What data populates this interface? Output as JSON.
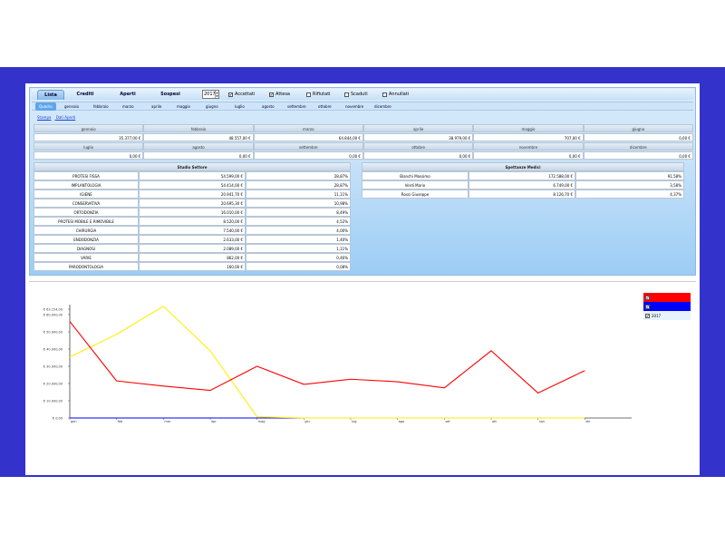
{
  "tabs": [
    "Lista",
    "Crediti",
    "Aperti",
    "Sospesi"
  ],
  "year": "2017",
  "filters": [
    {
      "label": "Accettati",
      "checked": true
    },
    {
      "label": "Attesa",
      "checked": true
    },
    {
      "label": "Rifiutati",
      "checked": false
    },
    {
      "label": "Scaduti",
      "checked": false
    },
    {
      "label": "Annullati",
      "checked": false
    }
  ],
  "month_tabs": [
    "Quadro",
    "gennaio",
    "febbraio",
    "marzo",
    "aprile",
    "maggio",
    "giugno",
    "luglio",
    "agosto",
    "settembre",
    "ottobre",
    "novembre",
    "dicembre"
  ],
  "links": [
    "Stampa",
    "Dati Aperti"
  ],
  "months_row1": [
    {
      "label": "gennaio",
      "value": "35.377,00 €"
    },
    {
      "label": "febbraio",
      "value": "48.557,00 €"
    },
    {
      "label": "marzo",
      "value": "64.844,00 €"
    },
    {
      "label": "aprile",
      "value": "38.979,00 €"
    },
    {
      "label": "maggio",
      "value": "707,00 €"
    },
    {
      "label": "giugno",
      "value": "0,00 €"
    }
  ],
  "months_row2": [
    {
      "label": "luglio",
      "value": "0,00 €"
    },
    {
      "label": "agosto",
      "value": "0,00 €"
    },
    {
      "label": "settembre",
      "value": "0,00 €"
    },
    {
      "label": "ottobre",
      "value": "0,00 €"
    },
    {
      "label": "novembre",
      "value": "0,00 €"
    },
    {
      "label": "dicembre",
      "value": "0,00 €"
    }
  ],
  "studio_settore": {
    "title": "Studio Settore",
    "rows": [
      [
        "PROTESI FISSA",
        "54.599,00 €",
        "28,87%"
      ],
      [
        "IMPLANTOLOGIA",
        "54.414,00 €",
        "28,87%"
      ],
      [
        "IGIENE",
        "20.941,70 €",
        "11,11%"
      ],
      [
        "CONSERVATIVA",
        "20.695,30 €",
        "10,98%"
      ],
      [
        "ORTODONZIA",
        "16.010,00 €",
        "8,49%"
      ],
      [
        "PROTESI MOBILE E RIMOVIBILE",
        "8.520,00 €",
        "4,52%"
      ],
      [
        "CHIRURGIA",
        "7.540,00 €",
        "4,00%"
      ],
      [
        "ENDODONZIA",
        "2.633,00 €",
        "1,40%"
      ],
      [
        "DIAGNOSI",
        "2.089,00 €",
        "1,11%"
      ],
      [
        "VARIE",
        "862,00 €",
        "0,46%"
      ],
      [
        "PARODONTOLOGIA",
        "160,00 €",
        "0,08%"
      ]
    ]
  },
  "spettanze_medici": {
    "title": "Spettanze Medici",
    "rows": [
      [
        "Bianchi Massimo",
        "172.588,00 €",
        "91,58%"
      ],
      [
        "Verdi Mario",
        "6.749,00 €",
        "3,58%"
      ],
      [
        "Rossi Giuseppe",
        "8.126,70 €",
        "4,37%"
      ]
    ]
  },
  "chart_data": {
    "type": "line",
    "categories": [
      "gen",
      "feb",
      "mar",
      "apr",
      "mag",
      "giu",
      "lug",
      "ago",
      "set",
      "ott",
      "nov",
      "dic"
    ],
    "y_ticks": [
      "€ 0,00",
      "€ 10.000,00",
      "€ 20.000,00",
      "€ 30.000,00",
      "€ 40.000,00",
      "€ 50.000,00",
      "€ 60.000,00",
      "€ 63.154,00"
    ],
    "ylim": [
      0,
      63154
    ],
    "series": [
      {
        "name": "",
        "color": "#ff0000",
        "values": [
          56000,
          21500,
          18500,
          16000,
          30000,
          19500,
          22500,
          21000,
          17500,
          39000,
          14500,
          27500
        ]
      },
      {
        "name": "",
        "color": "#0000ff",
        "values": [
          0,
          0,
          0,
          0,
          0,
          0,
          0,
          0,
          0,
          0,
          0,
          0
        ]
      },
      {
        "name": "2017",
        "color": "#ffee00",
        "values": [
          35377,
          48557,
          64844,
          38979,
          707,
          0,
          0,
          0,
          0,
          0,
          0,
          0
        ]
      }
    ],
    "legend": [
      {
        "name": "",
        "color": "#ff0000",
        "checked": true
      },
      {
        "name": "",
        "color": "#0000ff",
        "checked": true
      },
      {
        "name": "2017",
        "color": "#e6f2fc",
        "checked": true
      }
    ]
  }
}
